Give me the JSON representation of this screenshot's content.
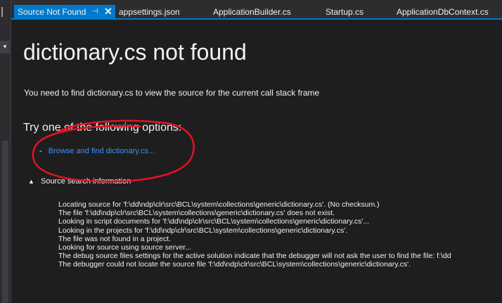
{
  "tabs": [
    {
      "label": "Source Not Found",
      "active": true
    },
    {
      "label": "appsettings.json"
    },
    {
      "label": "ApplicationBuilder.cs"
    },
    {
      "label": "Startup.cs"
    },
    {
      "label": "ApplicationDbContext.cs"
    }
  ],
  "page": {
    "title": "dictionary.cs not found",
    "description": "You need to find dictionary.cs to view the source for the current call stack frame",
    "options_heading": "Try one of the following options:",
    "browse_link": "Browse and find dictionary.cs...",
    "source_search_toggle": "Source search information"
  },
  "log_lines": [
    "Locating source for 'f:\\dd\\ndp\\clr\\src\\BCL\\system\\collections\\generic\\dictionary.cs'. (No checksum.)",
    "The file 'f:\\dd\\ndp\\clr\\src\\BCL\\system\\collections\\generic\\dictionary.cs' does not exist.",
    "Looking in script documents for 'f:\\dd\\ndp\\clr\\src\\BCL\\system\\collections\\generic\\dictionary.cs'...",
    "Looking in the projects for 'f:\\dd\\ndp\\clr\\src\\BCL\\system\\collections\\generic\\dictionary.cs'.",
    "The file was not found in a project.",
    "Looking for source using source server...",
    "The debug source files settings for the active solution indicate that the debugger will not ask the user to find the file: f:\\dd",
    "The debugger could not locate the source file 'f:\\dd\\ndp\\clr\\src\\BCL\\system\\collections\\generic\\dictionary.cs'."
  ],
  "colors": {
    "background": "#1e1e1e",
    "tab_active": "#007acc",
    "link": "#3794ff",
    "annotation": "#e81123"
  }
}
